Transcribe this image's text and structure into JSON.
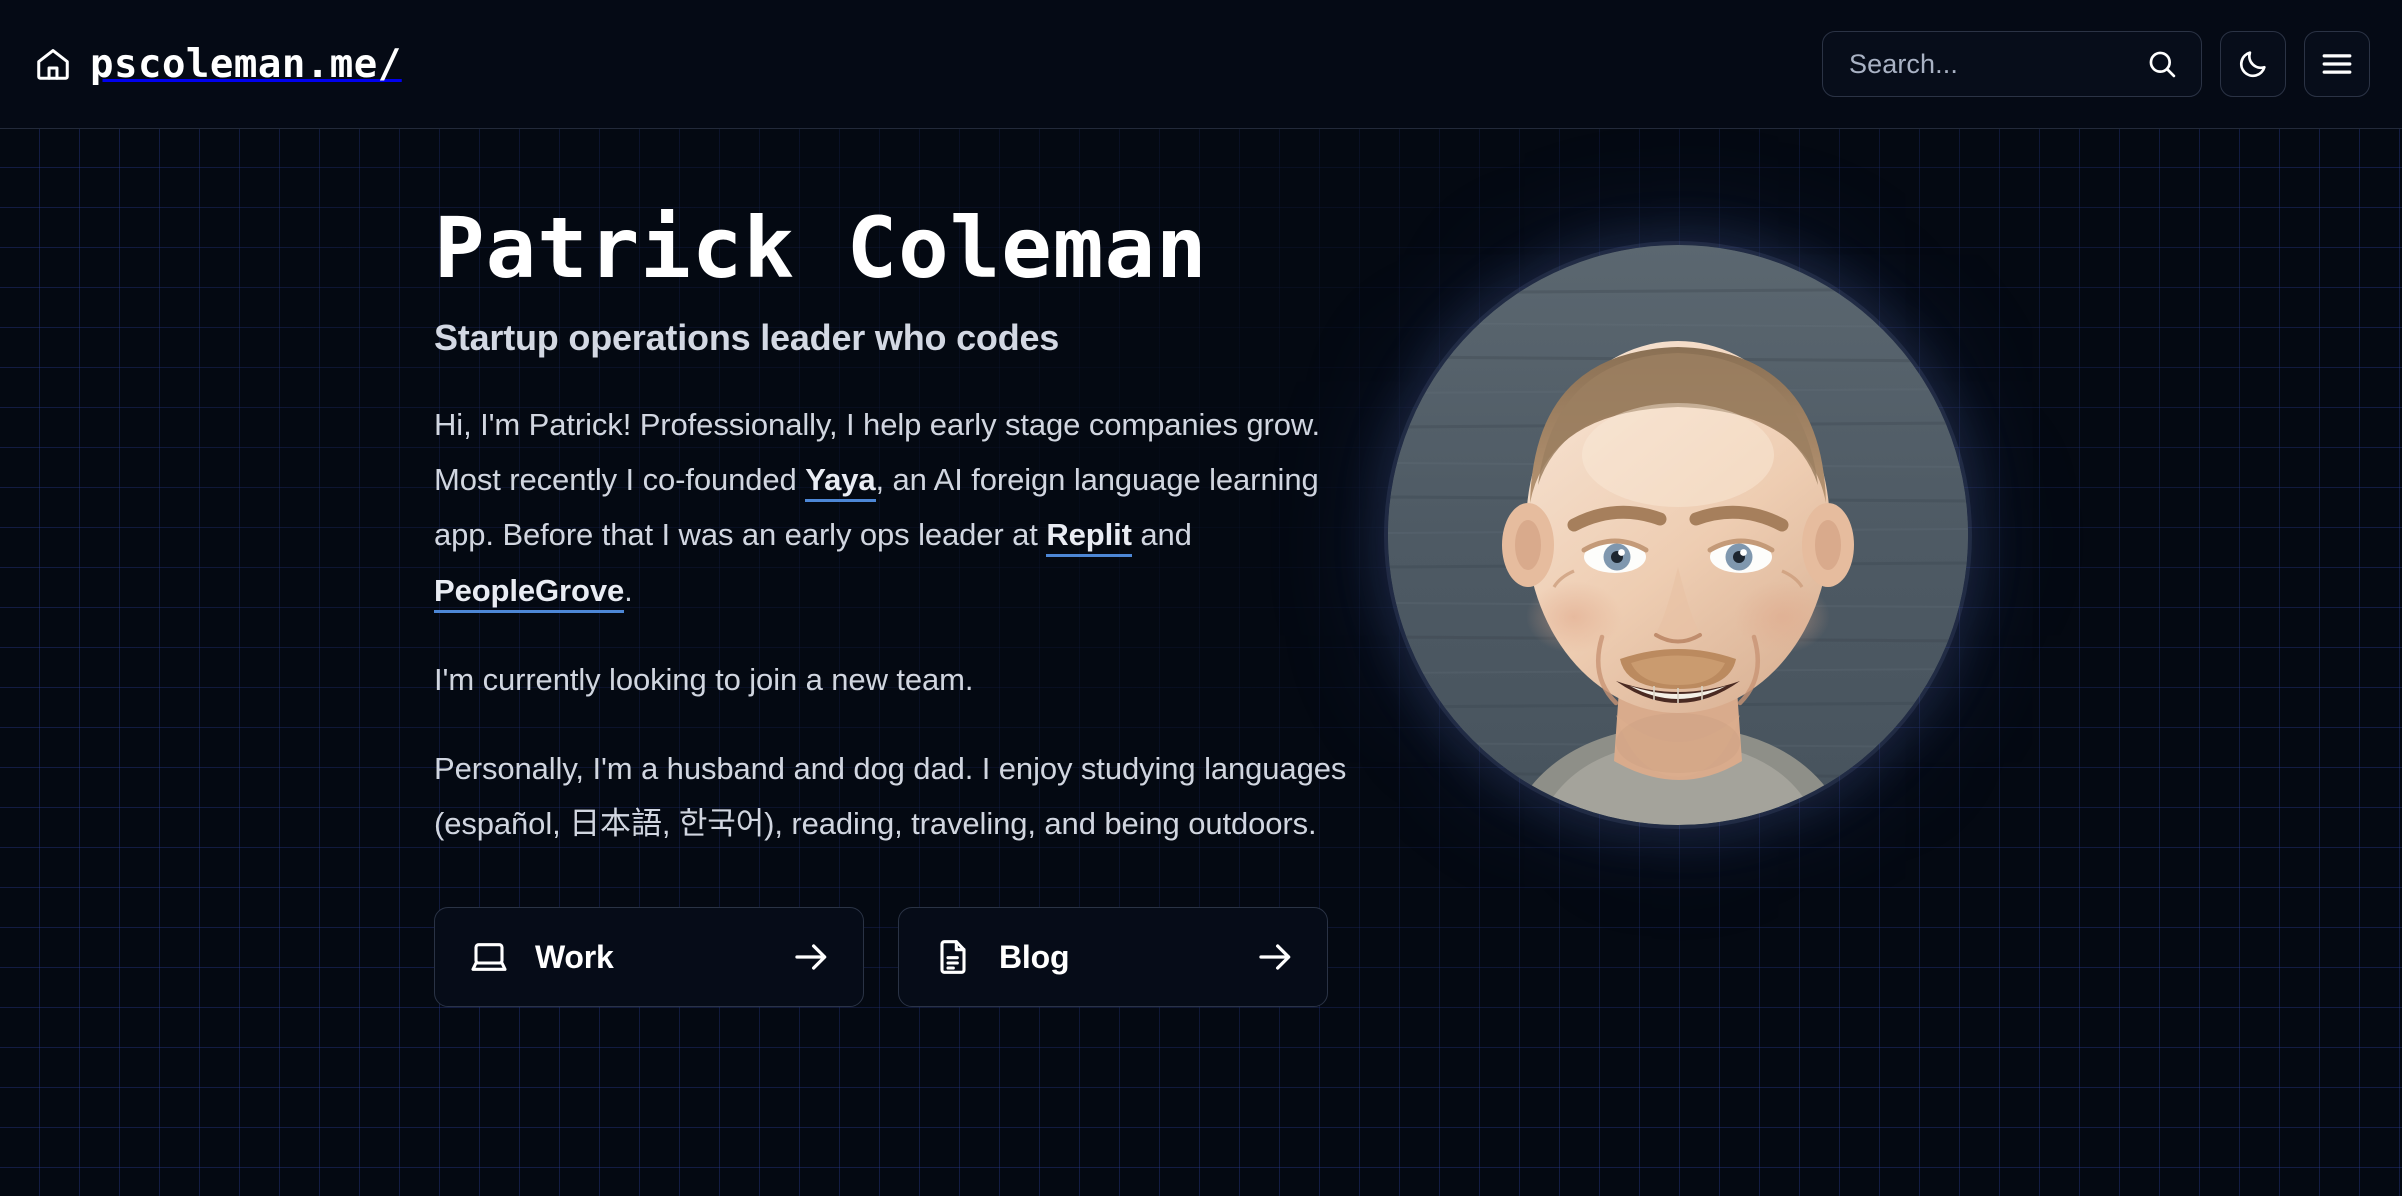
{
  "header": {
    "home_icon": "home-icon",
    "brand_label": "pscoleman.me/",
    "search": {
      "placeholder": "Search...",
      "value": "",
      "icon": "search-icon"
    },
    "theme_toggle": {
      "icon": "moon-icon",
      "label": "Toggle dark mode"
    },
    "menu": {
      "icon": "hamburger-menu-icon",
      "label": "Open menu"
    }
  },
  "hero": {
    "title": "Patrick Coleman",
    "tagline": "Startup operations leader who codes",
    "paragraphs": [
      {
        "segments": [
          {
            "text": "Hi, I'm Patrick! Professionally, I help early stage companies grow. Most recently I co-founded "
          },
          {
            "text": "Yaya",
            "link": true
          },
          {
            "text": ", an AI foreign language learning app. Before that I was an early ops leader at "
          },
          {
            "text": "Replit",
            "link": true
          },
          {
            "text": " and "
          },
          {
            "text": "PeopleGrove",
            "link": true
          },
          {
            "text": "."
          }
        ]
      },
      {
        "segments": [
          {
            "text": "I'm currently looking to join a new team."
          }
        ]
      },
      {
        "segments": [
          {
            "text": "Personally, I'm a husband and dog dad. I enjoy studying languages (español, 日本語, 한국어), reading, traveling, and being outdoors."
          }
        ]
      }
    ],
    "p1_text": "Hi, I'm Patrick! Professionally, I help early stage companies grow. Most recently I co-founded Yaya, an AI foreign language learning app. Before that I was an early ops leader at Replit and PeopleGrove.",
    "p1_a": "Hi, I'm Patrick! Professionally, I help early stage companies grow. Most recently I co-founded ",
    "p1_link1": "Yaya",
    "p1_b": ", an AI foreign language learning app. Before that I was an early ops leader at ",
    "p1_link2": "Replit",
    "p1_c": " and ",
    "p1_link3": "PeopleGrove",
    "p1_d": ".",
    "p2": "I'm currently looking to join a new team.",
    "p3": "Personally, I'm a husband and dog dad. I enjoy studying languages (español, 日本語, 한국어), reading, traveling, and being outdoors.",
    "avatar_alt": "Portrait photo of Patrick Coleman"
  },
  "cta": [
    {
      "label": "Work",
      "icon": "laptop-icon",
      "arrow": "arrow-right-icon"
    },
    {
      "label": "Blog",
      "icon": "file-text-icon",
      "arrow": "arrow-right-icon"
    }
  ],
  "colors": {
    "page_background": "#040912",
    "header_background": "#050a15",
    "header_border": "#232a3a",
    "grid_line": "#2a3a8c",
    "text_primary": "#ffffff",
    "text_body": "#d1d6e0",
    "text_muted": "#a9b2c4",
    "link_underline": "#4d87d6",
    "control_border": "#2b3345"
  }
}
